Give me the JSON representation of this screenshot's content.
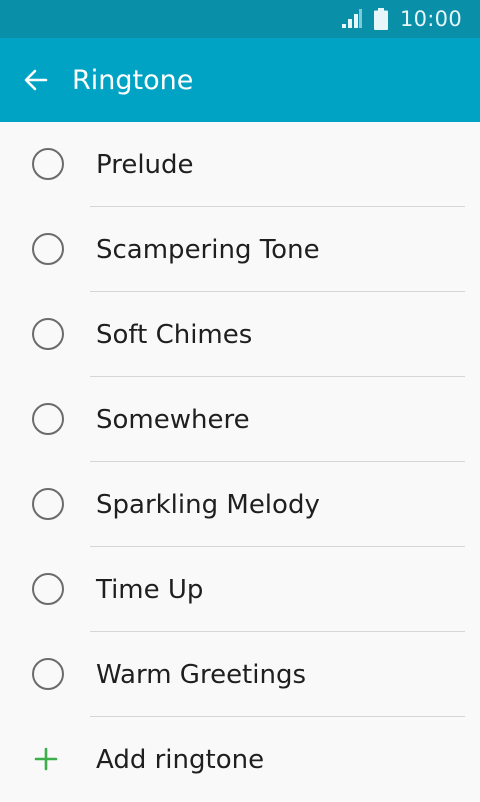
{
  "status_bar": {
    "time": "10:00",
    "signal_icon": "signal-icon",
    "battery_icon": "battery-icon"
  },
  "app_bar": {
    "title": "Ringtone",
    "back_icon": "arrow-left-icon",
    "background": "#00a3c4"
  },
  "ringtones": [
    {
      "label": "Prelude",
      "selected": false
    },
    {
      "label": "Scampering Tone",
      "selected": false
    },
    {
      "label": "Soft Chimes",
      "selected": false
    },
    {
      "label": "Somewhere",
      "selected": false
    },
    {
      "label": "Sparkling Melody",
      "selected": false
    },
    {
      "label": "Time Up",
      "selected": false
    },
    {
      "label": "Warm Greetings",
      "selected": false
    }
  ],
  "add_ringtone": {
    "label": "Add ringtone",
    "icon": "plus-icon",
    "icon_color": "#3cae4a"
  }
}
